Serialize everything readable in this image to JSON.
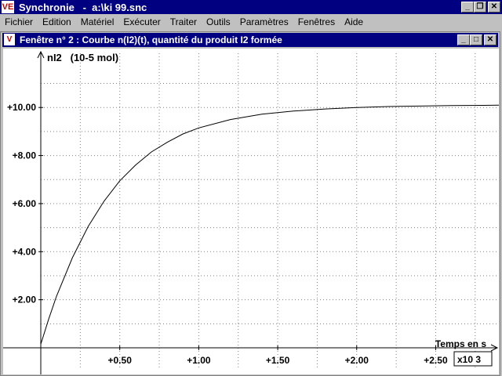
{
  "app": {
    "title": "Synchronie   -  a:\\ki 99.snc",
    "icon_label": "VE",
    "window_buttons": [
      "minimize-icon",
      "restore-icon",
      "close-icon"
    ]
  },
  "menu": {
    "items": [
      "Fichier",
      "Edition",
      "Matériel",
      "Exécuter",
      "Traiter",
      "Outils",
      "Paramètres",
      "Fenêtres",
      "Aide"
    ]
  },
  "child_window": {
    "title": "Fenêtre n° 2 : Courbe n(I2)(t), quantité du produit I2 formée"
  },
  "chart_data": {
    "type": "line",
    "title": "",
    "ylabel": "nI2   (10-5 mol)",
    "xlabel": "Temps en s",
    "x_multiplier": "x10 3",
    "x_ticks": [
      "+0.50",
      "+1.00",
      "+1.50",
      "+2.00",
      "+2.50"
    ],
    "y_ticks": [
      "+2.00",
      "+4.00",
      "+6.00",
      "+8.00",
      "+10.00"
    ],
    "xlim": [
      0,
      2.9
    ],
    "ylim": [
      0,
      11.8
    ],
    "grid": true,
    "series": [
      {
        "x": [
          0,
          0.05,
          0.1,
          0.2,
          0.3,
          0.4,
          0.5,
          0.6,
          0.7,
          0.8,
          0.9,
          1.0,
          1.2,
          1.4,
          1.6,
          1.8,
          2.0,
          2.2,
          2.4,
          2.6,
          2.8,
          2.9
        ],
        "values": [
          0.15,
          1.2,
          2.15,
          3.75,
          5.05,
          6.1,
          6.95,
          7.6,
          8.15,
          8.55,
          8.9,
          9.15,
          9.5,
          9.72,
          9.85,
          9.94,
          10.0,
          10.04,
          10.06,
          10.08,
          10.09,
          10.1
        ]
      }
    ]
  }
}
